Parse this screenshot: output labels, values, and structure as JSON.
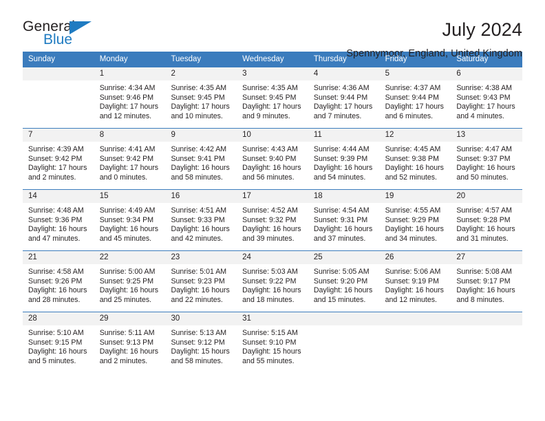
{
  "logo": {
    "word1": "General",
    "word2": "Blue",
    "triangle_color": "#1f7bc1"
  },
  "header": {
    "title": "July 2024",
    "location": "Spennymoor, England, United Kingdom"
  },
  "theme": {
    "header_blue": "#3b7cbd",
    "date_band": "#f2f2f2",
    "text": "#231f20"
  },
  "weekdays": [
    "Sunday",
    "Monday",
    "Tuesday",
    "Wednesday",
    "Thursday",
    "Friday",
    "Saturday"
  ],
  "weeks": [
    [
      {
        "day": "",
        "sunrise": "",
        "sunset": "",
        "daylight1": "",
        "daylight2": ""
      },
      {
        "day": "1",
        "sunrise": "Sunrise: 4:34 AM",
        "sunset": "Sunset: 9:46 PM",
        "daylight1": "Daylight: 17 hours",
        "daylight2": "and 12 minutes."
      },
      {
        "day": "2",
        "sunrise": "Sunrise: 4:35 AM",
        "sunset": "Sunset: 9:45 PM",
        "daylight1": "Daylight: 17 hours",
        "daylight2": "and 10 minutes."
      },
      {
        "day": "3",
        "sunrise": "Sunrise: 4:35 AM",
        "sunset": "Sunset: 9:45 PM",
        "daylight1": "Daylight: 17 hours",
        "daylight2": "and 9 minutes."
      },
      {
        "day": "4",
        "sunrise": "Sunrise: 4:36 AM",
        "sunset": "Sunset: 9:44 PM",
        "daylight1": "Daylight: 17 hours",
        "daylight2": "and 7 minutes."
      },
      {
        "day": "5",
        "sunrise": "Sunrise: 4:37 AM",
        "sunset": "Sunset: 9:44 PM",
        "daylight1": "Daylight: 17 hours",
        "daylight2": "and 6 minutes."
      },
      {
        "day": "6",
        "sunrise": "Sunrise: 4:38 AM",
        "sunset": "Sunset: 9:43 PM",
        "daylight1": "Daylight: 17 hours",
        "daylight2": "and 4 minutes."
      }
    ],
    [
      {
        "day": "7",
        "sunrise": "Sunrise: 4:39 AM",
        "sunset": "Sunset: 9:42 PM",
        "daylight1": "Daylight: 17 hours",
        "daylight2": "and 2 minutes."
      },
      {
        "day": "8",
        "sunrise": "Sunrise: 4:41 AM",
        "sunset": "Sunset: 9:42 PM",
        "daylight1": "Daylight: 17 hours",
        "daylight2": "and 0 minutes."
      },
      {
        "day": "9",
        "sunrise": "Sunrise: 4:42 AM",
        "sunset": "Sunset: 9:41 PM",
        "daylight1": "Daylight: 16 hours",
        "daylight2": "and 58 minutes."
      },
      {
        "day": "10",
        "sunrise": "Sunrise: 4:43 AM",
        "sunset": "Sunset: 9:40 PM",
        "daylight1": "Daylight: 16 hours",
        "daylight2": "and 56 minutes."
      },
      {
        "day": "11",
        "sunrise": "Sunrise: 4:44 AM",
        "sunset": "Sunset: 9:39 PM",
        "daylight1": "Daylight: 16 hours",
        "daylight2": "and 54 minutes."
      },
      {
        "day": "12",
        "sunrise": "Sunrise: 4:45 AM",
        "sunset": "Sunset: 9:38 PM",
        "daylight1": "Daylight: 16 hours",
        "daylight2": "and 52 minutes."
      },
      {
        "day": "13",
        "sunrise": "Sunrise: 4:47 AM",
        "sunset": "Sunset: 9:37 PM",
        "daylight1": "Daylight: 16 hours",
        "daylight2": "and 50 minutes."
      }
    ],
    [
      {
        "day": "14",
        "sunrise": "Sunrise: 4:48 AM",
        "sunset": "Sunset: 9:36 PM",
        "daylight1": "Daylight: 16 hours",
        "daylight2": "and 47 minutes."
      },
      {
        "day": "15",
        "sunrise": "Sunrise: 4:49 AM",
        "sunset": "Sunset: 9:34 PM",
        "daylight1": "Daylight: 16 hours",
        "daylight2": "and 45 minutes."
      },
      {
        "day": "16",
        "sunrise": "Sunrise: 4:51 AM",
        "sunset": "Sunset: 9:33 PM",
        "daylight1": "Daylight: 16 hours",
        "daylight2": "and 42 minutes."
      },
      {
        "day": "17",
        "sunrise": "Sunrise: 4:52 AM",
        "sunset": "Sunset: 9:32 PM",
        "daylight1": "Daylight: 16 hours",
        "daylight2": "and 39 minutes."
      },
      {
        "day": "18",
        "sunrise": "Sunrise: 4:54 AM",
        "sunset": "Sunset: 9:31 PM",
        "daylight1": "Daylight: 16 hours",
        "daylight2": "and 37 minutes."
      },
      {
        "day": "19",
        "sunrise": "Sunrise: 4:55 AM",
        "sunset": "Sunset: 9:29 PM",
        "daylight1": "Daylight: 16 hours",
        "daylight2": "and 34 minutes."
      },
      {
        "day": "20",
        "sunrise": "Sunrise: 4:57 AM",
        "sunset": "Sunset: 9:28 PM",
        "daylight1": "Daylight: 16 hours",
        "daylight2": "and 31 minutes."
      }
    ],
    [
      {
        "day": "21",
        "sunrise": "Sunrise: 4:58 AM",
        "sunset": "Sunset: 9:26 PM",
        "daylight1": "Daylight: 16 hours",
        "daylight2": "and 28 minutes."
      },
      {
        "day": "22",
        "sunrise": "Sunrise: 5:00 AM",
        "sunset": "Sunset: 9:25 PM",
        "daylight1": "Daylight: 16 hours",
        "daylight2": "and 25 minutes."
      },
      {
        "day": "23",
        "sunrise": "Sunrise: 5:01 AM",
        "sunset": "Sunset: 9:23 PM",
        "daylight1": "Daylight: 16 hours",
        "daylight2": "and 22 minutes."
      },
      {
        "day": "24",
        "sunrise": "Sunrise: 5:03 AM",
        "sunset": "Sunset: 9:22 PM",
        "daylight1": "Daylight: 16 hours",
        "daylight2": "and 18 minutes."
      },
      {
        "day": "25",
        "sunrise": "Sunrise: 5:05 AM",
        "sunset": "Sunset: 9:20 PM",
        "daylight1": "Daylight: 16 hours",
        "daylight2": "and 15 minutes."
      },
      {
        "day": "26",
        "sunrise": "Sunrise: 5:06 AM",
        "sunset": "Sunset: 9:19 PM",
        "daylight1": "Daylight: 16 hours",
        "daylight2": "and 12 minutes."
      },
      {
        "day": "27",
        "sunrise": "Sunrise: 5:08 AM",
        "sunset": "Sunset: 9:17 PM",
        "daylight1": "Daylight: 16 hours",
        "daylight2": "and 8 minutes."
      }
    ],
    [
      {
        "day": "28",
        "sunrise": "Sunrise: 5:10 AM",
        "sunset": "Sunset: 9:15 PM",
        "daylight1": "Daylight: 16 hours",
        "daylight2": "and 5 minutes."
      },
      {
        "day": "29",
        "sunrise": "Sunrise: 5:11 AM",
        "sunset": "Sunset: 9:13 PM",
        "daylight1": "Daylight: 16 hours",
        "daylight2": "and 2 minutes."
      },
      {
        "day": "30",
        "sunrise": "Sunrise: 5:13 AM",
        "sunset": "Sunset: 9:12 PM",
        "daylight1": "Daylight: 15 hours",
        "daylight2": "and 58 minutes."
      },
      {
        "day": "31",
        "sunrise": "Sunrise: 5:15 AM",
        "sunset": "Sunset: 9:10 PM",
        "daylight1": "Daylight: 15 hours",
        "daylight2": "and 55 minutes."
      },
      {
        "day": "",
        "sunrise": "",
        "sunset": "",
        "daylight1": "",
        "daylight2": ""
      },
      {
        "day": "",
        "sunrise": "",
        "sunset": "",
        "daylight1": "",
        "daylight2": ""
      },
      {
        "day": "",
        "sunrise": "",
        "sunset": "",
        "daylight1": "",
        "daylight2": ""
      }
    ]
  ]
}
